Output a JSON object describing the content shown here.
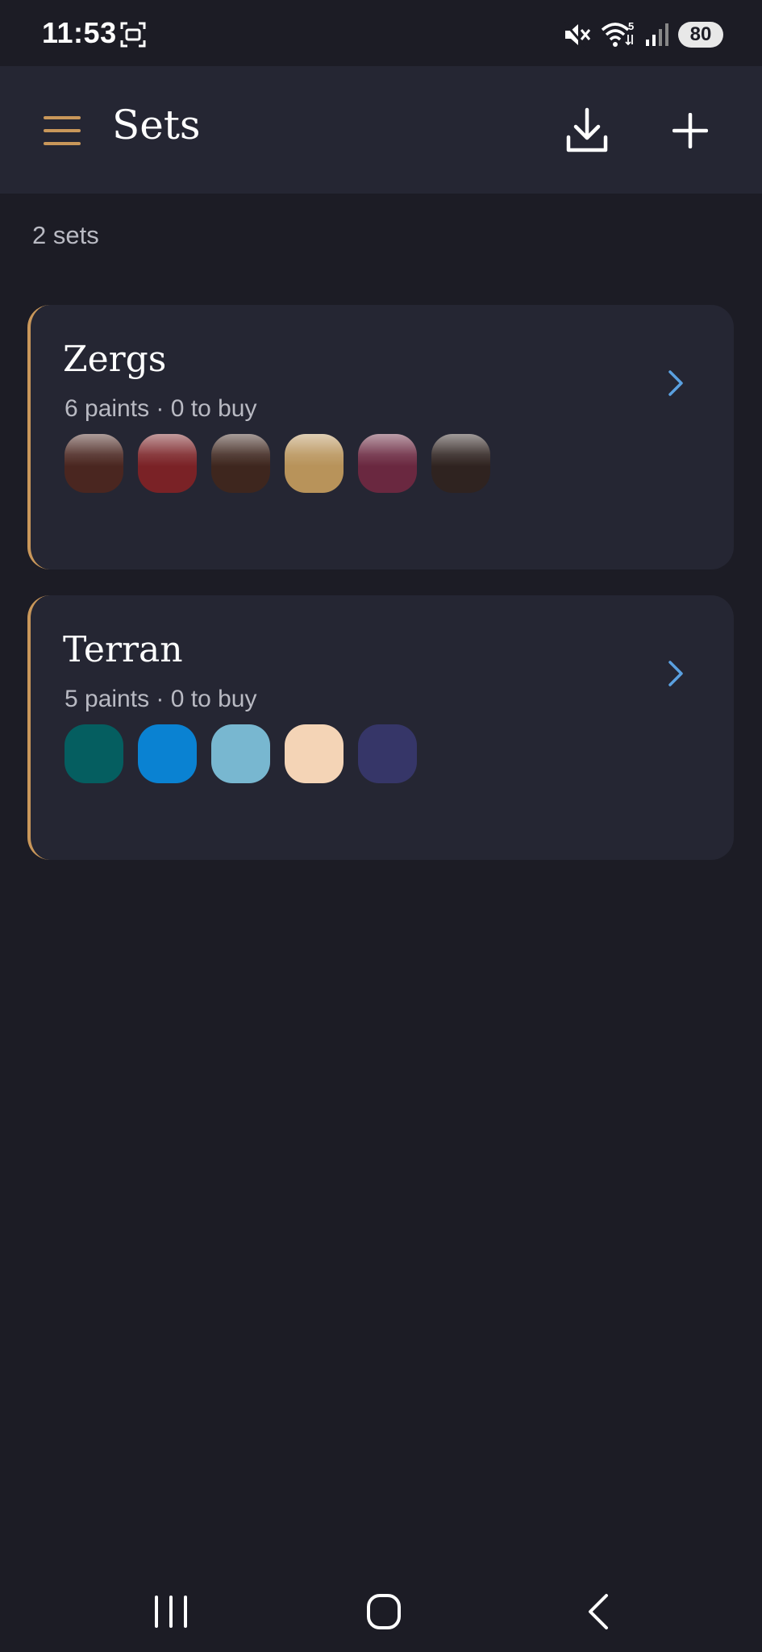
{
  "status_bar": {
    "time": "11:53",
    "battery": "80",
    "wifi_badge": "5"
  },
  "app_bar": {
    "title": "Sets",
    "menu_icon": "hamburger-menu-icon",
    "download_icon": "download-icon",
    "add_icon": "plus-icon"
  },
  "summary": {
    "count_label": "2 sets"
  },
  "sets": [
    {
      "name": "Zergs",
      "subtitle": "6 paints · 0 to buy",
      "accent": "#c9975a",
      "swatches": [
        {
          "color": "#4a2620",
          "style": "metallic"
        },
        {
          "color": "#7a2226",
          "style": "metallic"
        },
        {
          "color": "#3e261e",
          "style": "metallic"
        },
        {
          "color": "#b8935a",
          "style": "metallic"
        },
        {
          "color": "#6a2840",
          "style": "metallic"
        },
        {
          "color": "#2f2320",
          "style": "metallic"
        }
      ]
    },
    {
      "name": "Terran",
      "subtitle": "5 paints · 0 to buy",
      "accent": "#c9975a",
      "swatches": [
        {
          "color": "#055e60",
          "style": "flat"
        },
        {
          "color": "#0a82d2",
          "style": "flat"
        },
        {
          "color": "#78b7d0",
          "style": "flat"
        },
        {
          "color": "#f4d4b6",
          "style": "flat"
        },
        {
          "color": "#363668",
          "style": "flat"
        }
      ]
    }
  ],
  "colors": {
    "background": "#1c1c25",
    "surface": "#252633",
    "accent": "#c9975a",
    "chevron": "#5aa0e0",
    "secondary_text": "#b9bac3"
  }
}
